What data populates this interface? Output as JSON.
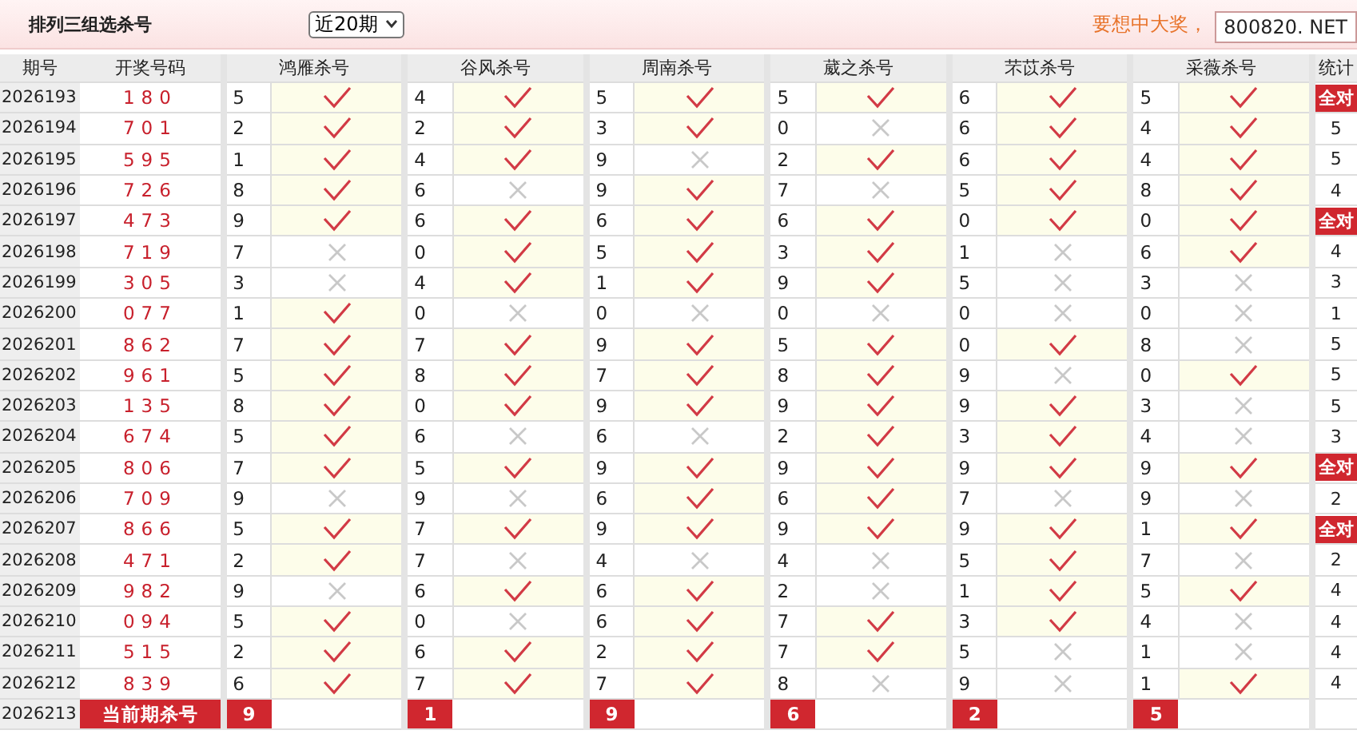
{
  "topbar": {
    "title": "排列三组选杀号",
    "range_select": "近20期",
    "slogan": "要想中大奖，",
    "site_badge": "800820. NET"
  },
  "columns": {
    "period": "期号",
    "draw": "开奖号码",
    "groups": [
      "鸿雁杀号",
      "谷风杀号",
      "周南杀号",
      "葳之杀号",
      "芣苡杀号",
      "采薇杀号"
    ],
    "stat": "统计"
  },
  "rows": [
    {
      "period": "2026193",
      "draw": "180",
      "kills": [
        {
          "num": "5",
          "hit": true
        },
        {
          "num": "4",
          "hit": true
        },
        {
          "num": "5",
          "hit": true
        },
        {
          "num": "5",
          "hit": true
        },
        {
          "num": "6",
          "hit": true
        },
        {
          "num": "5",
          "hit": true
        }
      ],
      "stat": "全对",
      "full": true
    },
    {
      "period": "2026194",
      "draw": "701",
      "kills": [
        {
          "num": "2",
          "hit": true
        },
        {
          "num": "2",
          "hit": true
        },
        {
          "num": "3",
          "hit": true
        },
        {
          "num": "0",
          "hit": false
        },
        {
          "num": "6",
          "hit": true
        },
        {
          "num": "4",
          "hit": true
        }
      ],
      "stat": "5",
      "full": false
    },
    {
      "period": "2026195",
      "draw": "595",
      "kills": [
        {
          "num": "1",
          "hit": true
        },
        {
          "num": "4",
          "hit": true
        },
        {
          "num": "9",
          "hit": false
        },
        {
          "num": "2",
          "hit": true
        },
        {
          "num": "6",
          "hit": true
        },
        {
          "num": "4",
          "hit": true
        }
      ],
      "stat": "5",
      "full": false
    },
    {
      "period": "2026196",
      "draw": "726",
      "kills": [
        {
          "num": "8",
          "hit": true
        },
        {
          "num": "6",
          "hit": false
        },
        {
          "num": "9",
          "hit": true
        },
        {
          "num": "7",
          "hit": false
        },
        {
          "num": "5",
          "hit": true
        },
        {
          "num": "8",
          "hit": true
        }
      ],
      "stat": "4",
      "full": false
    },
    {
      "period": "2026197",
      "draw": "473",
      "kills": [
        {
          "num": "9",
          "hit": true
        },
        {
          "num": "6",
          "hit": true
        },
        {
          "num": "6",
          "hit": true
        },
        {
          "num": "6",
          "hit": true
        },
        {
          "num": "0",
          "hit": true
        },
        {
          "num": "0",
          "hit": true
        }
      ],
      "stat": "全对",
      "full": true
    },
    {
      "period": "2026198",
      "draw": "719",
      "kills": [
        {
          "num": "7",
          "hit": false
        },
        {
          "num": "0",
          "hit": true
        },
        {
          "num": "5",
          "hit": true
        },
        {
          "num": "3",
          "hit": true
        },
        {
          "num": "1",
          "hit": false
        },
        {
          "num": "6",
          "hit": true
        }
      ],
      "stat": "4",
      "full": false
    },
    {
      "period": "2026199",
      "draw": "305",
      "kills": [
        {
          "num": "3",
          "hit": false
        },
        {
          "num": "4",
          "hit": true
        },
        {
          "num": "1",
          "hit": true
        },
        {
          "num": "9",
          "hit": true
        },
        {
          "num": "5",
          "hit": false
        },
        {
          "num": "3",
          "hit": false
        }
      ],
      "stat": "3",
      "full": false
    },
    {
      "period": "2026200",
      "draw": "077",
      "kills": [
        {
          "num": "1",
          "hit": true
        },
        {
          "num": "0",
          "hit": false
        },
        {
          "num": "0",
          "hit": false
        },
        {
          "num": "0",
          "hit": false
        },
        {
          "num": "0",
          "hit": false
        },
        {
          "num": "0",
          "hit": false
        }
      ],
      "stat": "1",
      "full": false
    },
    {
      "period": "2026201",
      "draw": "862",
      "kills": [
        {
          "num": "7",
          "hit": true
        },
        {
          "num": "7",
          "hit": true
        },
        {
          "num": "9",
          "hit": true
        },
        {
          "num": "5",
          "hit": true
        },
        {
          "num": "0",
          "hit": true
        },
        {
          "num": "8",
          "hit": false
        }
      ],
      "stat": "5",
      "full": false
    },
    {
      "period": "2026202",
      "draw": "961",
      "kills": [
        {
          "num": "5",
          "hit": true
        },
        {
          "num": "8",
          "hit": true
        },
        {
          "num": "7",
          "hit": true
        },
        {
          "num": "8",
          "hit": true
        },
        {
          "num": "9",
          "hit": false
        },
        {
          "num": "0",
          "hit": true
        }
      ],
      "stat": "5",
      "full": false
    },
    {
      "period": "2026203",
      "draw": "135",
      "kills": [
        {
          "num": "8",
          "hit": true
        },
        {
          "num": "0",
          "hit": true
        },
        {
          "num": "9",
          "hit": true
        },
        {
          "num": "9",
          "hit": true
        },
        {
          "num": "9",
          "hit": true
        },
        {
          "num": "3",
          "hit": false
        }
      ],
      "stat": "5",
      "full": false
    },
    {
      "period": "2026204",
      "draw": "674",
      "kills": [
        {
          "num": "5",
          "hit": true
        },
        {
          "num": "6",
          "hit": false
        },
        {
          "num": "6",
          "hit": false
        },
        {
          "num": "2",
          "hit": true
        },
        {
          "num": "3",
          "hit": true
        },
        {
          "num": "4",
          "hit": false
        }
      ],
      "stat": "3",
      "full": false
    },
    {
      "period": "2026205",
      "draw": "806",
      "kills": [
        {
          "num": "7",
          "hit": true
        },
        {
          "num": "5",
          "hit": true
        },
        {
          "num": "9",
          "hit": true
        },
        {
          "num": "9",
          "hit": true
        },
        {
          "num": "9",
          "hit": true
        },
        {
          "num": "9",
          "hit": true
        }
      ],
      "stat": "全对",
      "full": true
    },
    {
      "period": "2026206",
      "draw": "709",
      "kills": [
        {
          "num": "9",
          "hit": false
        },
        {
          "num": "9",
          "hit": false
        },
        {
          "num": "6",
          "hit": true
        },
        {
          "num": "6",
          "hit": true
        },
        {
          "num": "7",
          "hit": false
        },
        {
          "num": "9",
          "hit": false
        }
      ],
      "stat": "2",
      "full": false
    },
    {
      "period": "2026207",
      "draw": "866",
      "kills": [
        {
          "num": "5",
          "hit": true
        },
        {
          "num": "7",
          "hit": true
        },
        {
          "num": "9",
          "hit": true
        },
        {
          "num": "9",
          "hit": true
        },
        {
          "num": "9",
          "hit": true
        },
        {
          "num": "1",
          "hit": true
        }
      ],
      "stat": "全对",
      "full": true
    },
    {
      "period": "2026208",
      "draw": "471",
      "kills": [
        {
          "num": "2",
          "hit": true
        },
        {
          "num": "7",
          "hit": false
        },
        {
          "num": "4",
          "hit": false
        },
        {
          "num": "4",
          "hit": false
        },
        {
          "num": "5",
          "hit": true
        },
        {
          "num": "7",
          "hit": false
        }
      ],
      "stat": "2",
      "full": false
    },
    {
      "period": "2026209",
      "draw": "982",
      "kills": [
        {
          "num": "9",
          "hit": false
        },
        {
          "num": "6",
          "hit": true
        },
        {
          "num": "6",
          "hit": true
        },
        {
          "num": "2",
          "hit": false
        },
        {
          "num": "1",
          "hit": true
        },
        {
          "num": "5",
          "hit": true
        }
      ],
      "stat": "4",
      "full": false
    },
    {
      "period": "2026210",
      "draw": "094",
      "kills": [
        {
          "num": "5",
          "hit": true
        },
        {
          "num": "0",
          "hit": false
        },
        {
          "num": "6",
          "hit": true
        },
        {
          "num": "7",
          "hit": true
        },
        {
          "num": "3",
          "hit": true
        },
        {
          "num": "4",
          "hit": false
        }
      ],
      "stat": "4",
      "full": false
    },
    {
      "period": "2026211",
      "draw": "515",
      "kills": [
        {
          "num": "2",
          "hit": true
        },
        {
          "num": "6",
          "hit": true
        },
        {
          "num": "2",
          "hit": true
        },
        {
          "num": "7",
          "hit": true
        },
        {
          "num": "5",
          "hit": false
        },
        {
          "num": "1",
          "hit": false
        }
      ],
      "stat": "4",
      "full": false
    },
    {
      "period": "2026212",
      "draw": "839",
      "kills": [
        {
          "num": "6",
          "hit": true
        },
        {
          "num": "7",
          "hit": true
        },
        {
          "num": "7",
          "hit": true
        },
        {
          "num": "8",
          "hit": false
        },
        {
          "num": "9",
          "hit": false
        },
        {
          "num": "1",
          "hit": true
        }
      ],
      "stat": "4",
      "full": false
    }
  ],
  "current": {
    "period": "2026213",
    "label": "当前期杀号",
    "nums": [
      "9",
      "1",
      "9",
      "6",
      "2",
      "5"
    ]
  }
}
